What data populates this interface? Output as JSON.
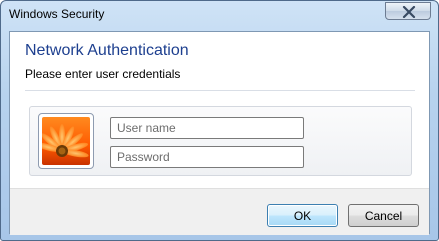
{
  "window": {
    "title": "Windows Security",
    "close_icon": "close-icon"
  },
  "dialog": {
    "heading": "Network Authentication",
    "subheading": "Please enter user credentials"
  },
  "credentials": {
    "user_tile_icon": "user-tile-flower-icon",
    "username": {
      "value": "",
      "placeholder": "User name"
    },
    "password": {
      "value": "",
      "placeholder": "Password"
    }
  },
  "buttons": {
    "ok_label": "OK",
    "cancel_label": "Cancel"
  },
  "colors": {
    "heading": "#1d3f8f",
    "ok_border": "#3c7fb1",
    "frame": "#a7c6e8"
  }
}
